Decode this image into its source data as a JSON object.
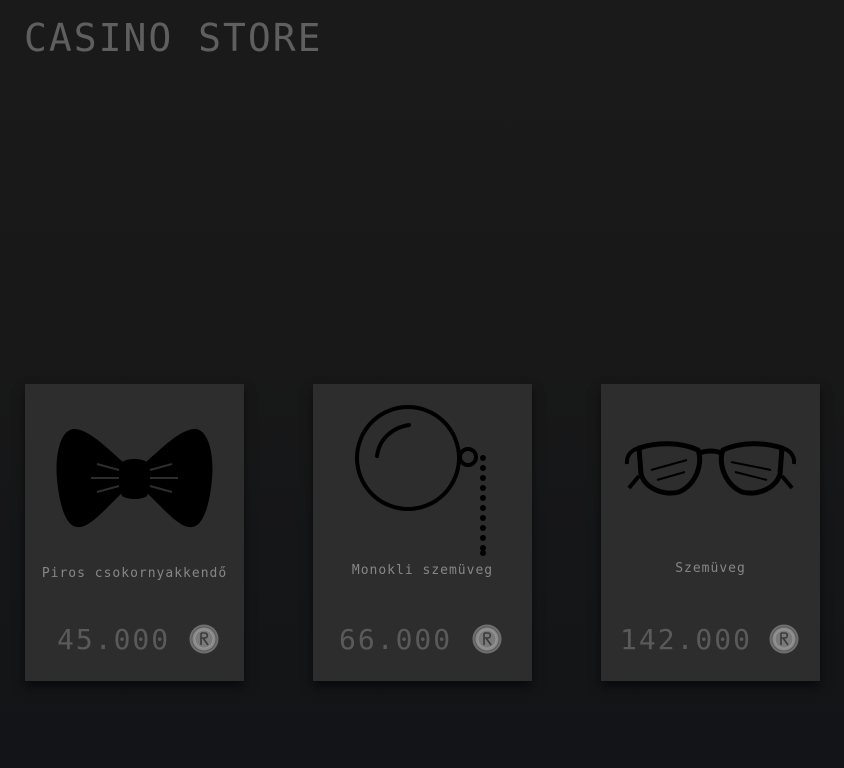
{
  "header": {
    "title": "CASINO STORE"
  },
  "items": [
    {
      "name": "Piros csokornyakkendő",
      "price": "45.000",
      "icon": "bow-tie-icon"
    },
    {
      "name": "Monokli szemüveg",
      "price": "66.000",
      "icon": "monocle-icon"
    },
    {
      "name": "Szemüveg",
      "price": "142.000",
      "icon": "glasses-icon"
    }
  ],
  "currency_icon": "coin-icon"
}
